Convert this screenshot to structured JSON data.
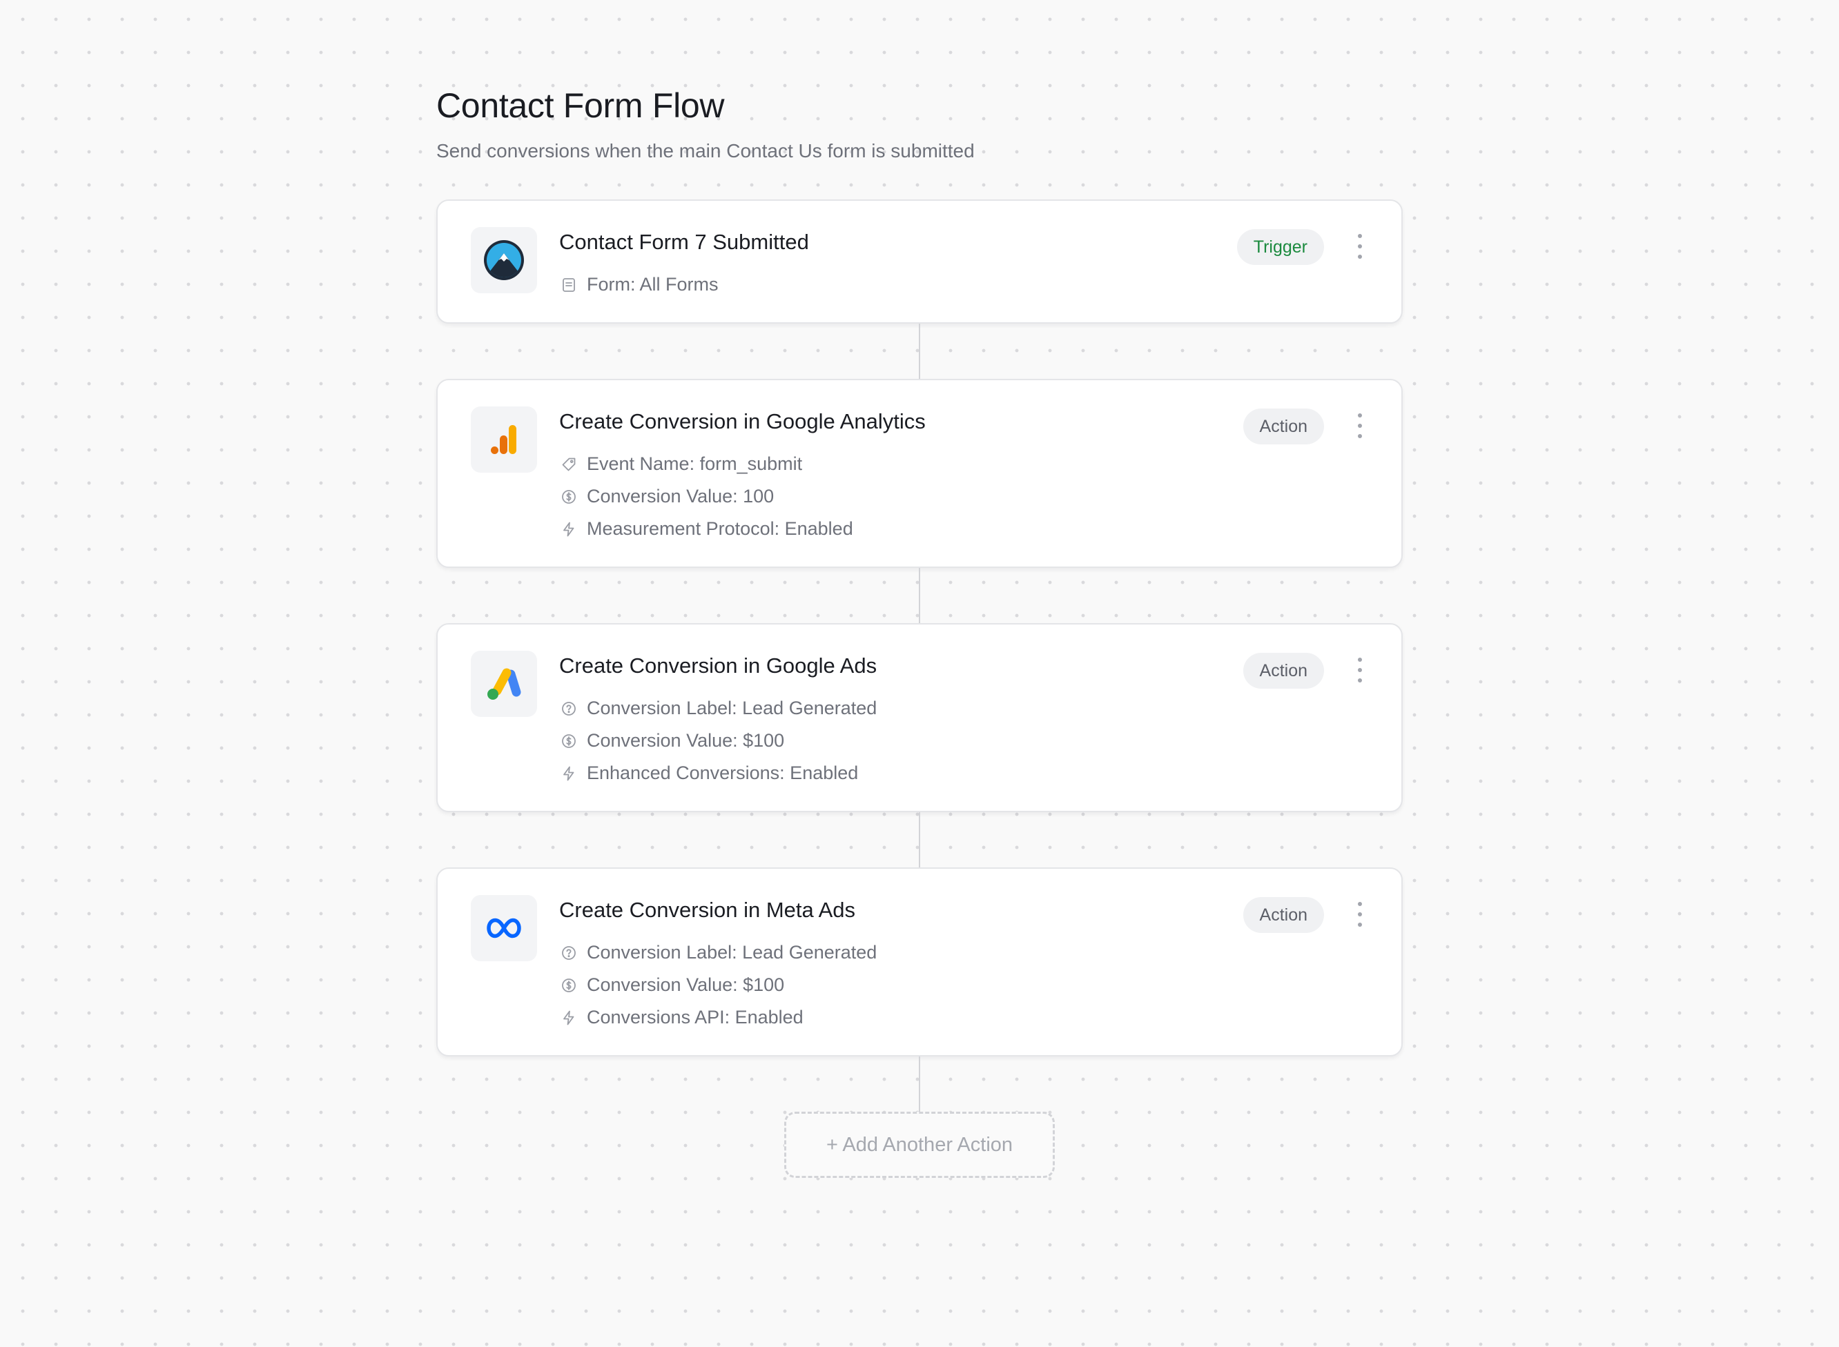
{
  "flow": {
    "title": "Contact Form Flow",
    "subtitle": "Send conversions when the main Contact Us form is submitted"
  },
  "trigger": {
    "icon": "contact-form-7-icon",
    "title": "Contact Form 7 Submitted",
    "badge": "Trigger",
    "details": [
      {
        "icon": "form-icon",
        "text": "Form: All Forms"
      }
    ]
  },
  "actions": [
    {
      "icon": "google-analytics-icon",
      "title": "Create Conversion in Google Analytics",
      "badge": "Action",
      "details": [
        {
          "icon": "tag-icon",
          "text": "Event Name: form_submit"
        },
        {
          "icon": "dollar-circle-icon",
          "text": "Conversion Value: 100"
        },
        {
          "icon": "lightning-icon",
          "text": "Measurement Protocol: Enabled"
        }
      ]
    },
    {
      "icon": "google-ads-icon",
      "title": "Create Conversion in Google Ads",
      "badge": "Action",
      "details": [
        {
          "icon": "question-circle-icon",
          "text": "Conversion Label: Lead Generated"
        },
        {
          "icon": "dollar-circle-icon",
          "text": "Conversion Value: $100"
        },
        {
          "icon": "lightning-icon",
          "text": "Enhanced Conversions: Enabled"
        }
      ]
    },
    {
      "icon": "meta-icon",
      "title": "Create Conversion in Meta Ads",
      "badge": "Action",
      "details": [
        {
          "icon": "question-circle-icon",
          "text": "Conversion Label: Lead Generated"
        },
        {
          "icon": "dollar-circle-icon",
          "text": "Conversion Value: $100"
        },
        {
          "icon": "lightning-icon",
          "text": "Conversions API: Enabled"
        }
      ]
    }
  ],
  "add_action": {
    "label": "+ Add Another Action"
  },
  "colors": {
    "background": "#f9f9f9",
    "card_border": "#e4e5e8",
    "trigger_badge_text": "#1b8a3e",
    "muted_text": "#6e717a",
    "connector": "#d2d3d7",
    "ga_orange": "#e8710a",
    "ga_yellow": "#f9ab00",
    "gads_blue": "#4285f4",
    "gads_yellow": "#fbbc04",
    "gads_green": "#34a853",
    "meta_blue": "#0866ff"
  }
}
